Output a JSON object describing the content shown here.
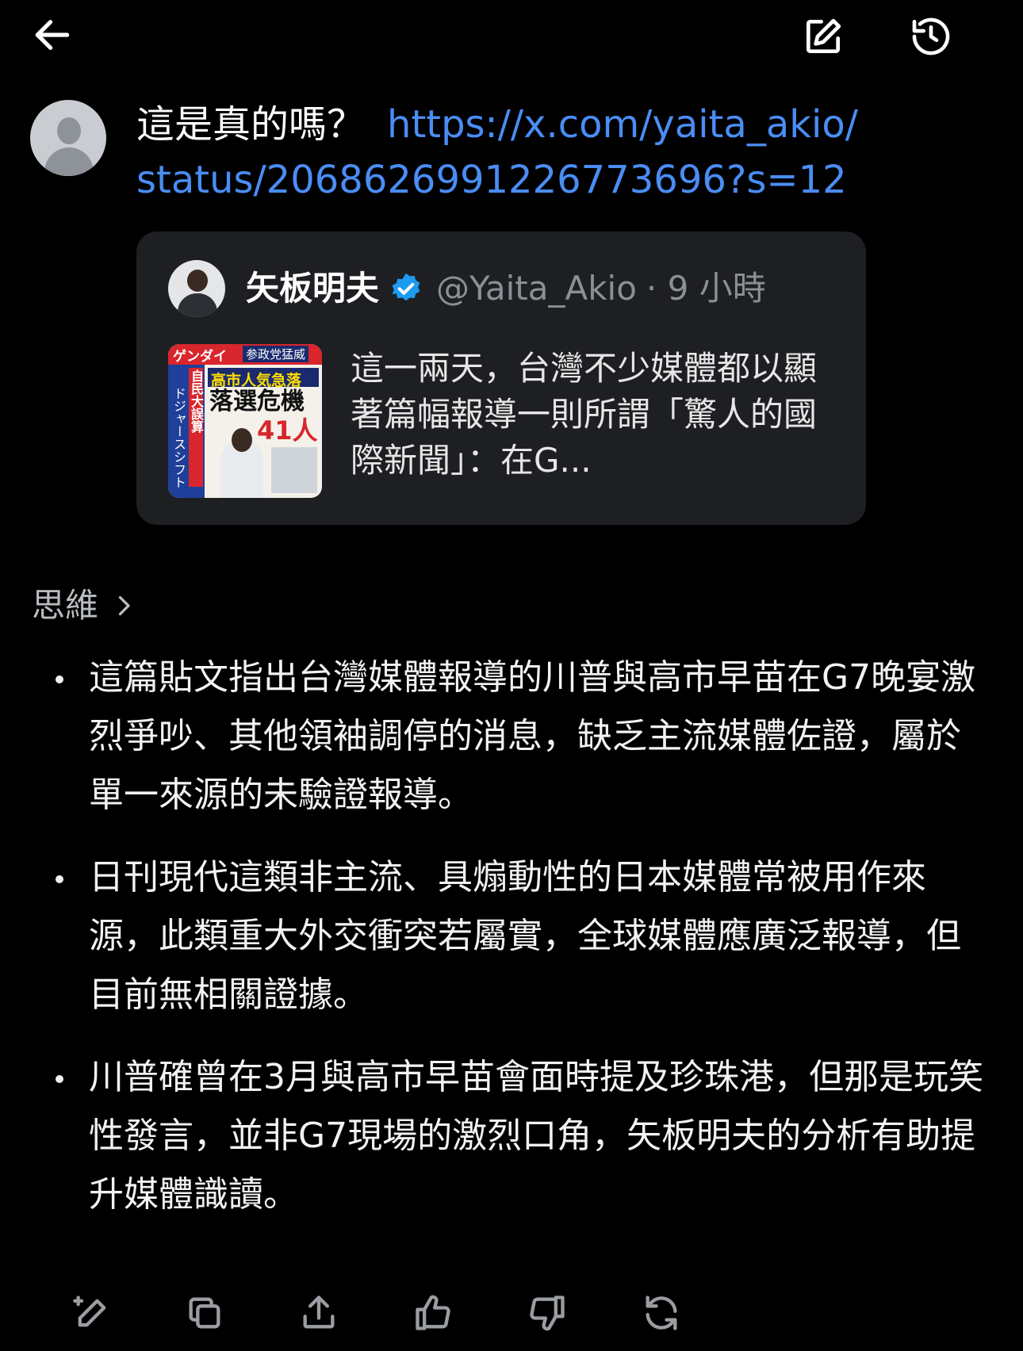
{
  "header": {
    "back_icon": "back-arrow-icon",
    "edit_icon": "compose-icon",
    "history_icon": "history-icon"
  },
  "message": {
    "question": "這是真的嗎？",
    "link": "https://x.com/yaita_akio/status/2068626991226773696?s=12",
    "link_line1": "https://x.com/yaita_akio/",
    "link_line2": "status/2068626991226773696?s=12"
  },
  "quote": {
    "name": "矢板明夫",
    "handle": "@Yaita_Akio",
    "time": "· 9 小時",
    "text": "這一兩天，台灣不少媒體都以顯著篇幅報導一則所謂「驚人的國際新聞」：在G...",
    "thumbnail": {
      "masthead": "ゲンダイ",
      "headline1": "参政党猛威",
      "headline2": "高市人気急落",
      "headline3": "落選危機",
      "headline4": "41人",
      "side1": "自民大誤算",
      "side2": "ドジャースシフト"
    }
  },
  "thinking": {
    "label": "思維"
  },
  "bullets": [
    "這篇貼文指出台灣媒體報導的川普與高市早苗在G7晚宴激烈爭吵、其他領袖調停的消息，缺乏主流媒體佐證，屬於單一來源的未驗證報導。",
    "日刊現代這類非主流、具煽動性的日本媒體常被用作來源，此類重大外交衝突若屬實，全球媒體應廣泛報導，但目前無相關證據。",
    "川普確曾在3月與高市早苗會面時提及珍珠港，但那是玩笑性發言，並非G7現場的激烈口角，矢板明夫的分析有助提升媒體識讀。"
  ],
  "toolbar": {
    "icons": [
      "edit-pen-icon",
      "copy-icon",
      "share-icon",
      "thumbs-up-icon",
      "thumbs-down-icon",
      "regenerate-icon"
    ]
  },
  "colors": {
    "background": "#000000",
    "link": "#4a8df5",
    "card": "#1e1f22",
    "muted": "#8b8f96",
    "verified": "#1d9bf0"
  }
}
